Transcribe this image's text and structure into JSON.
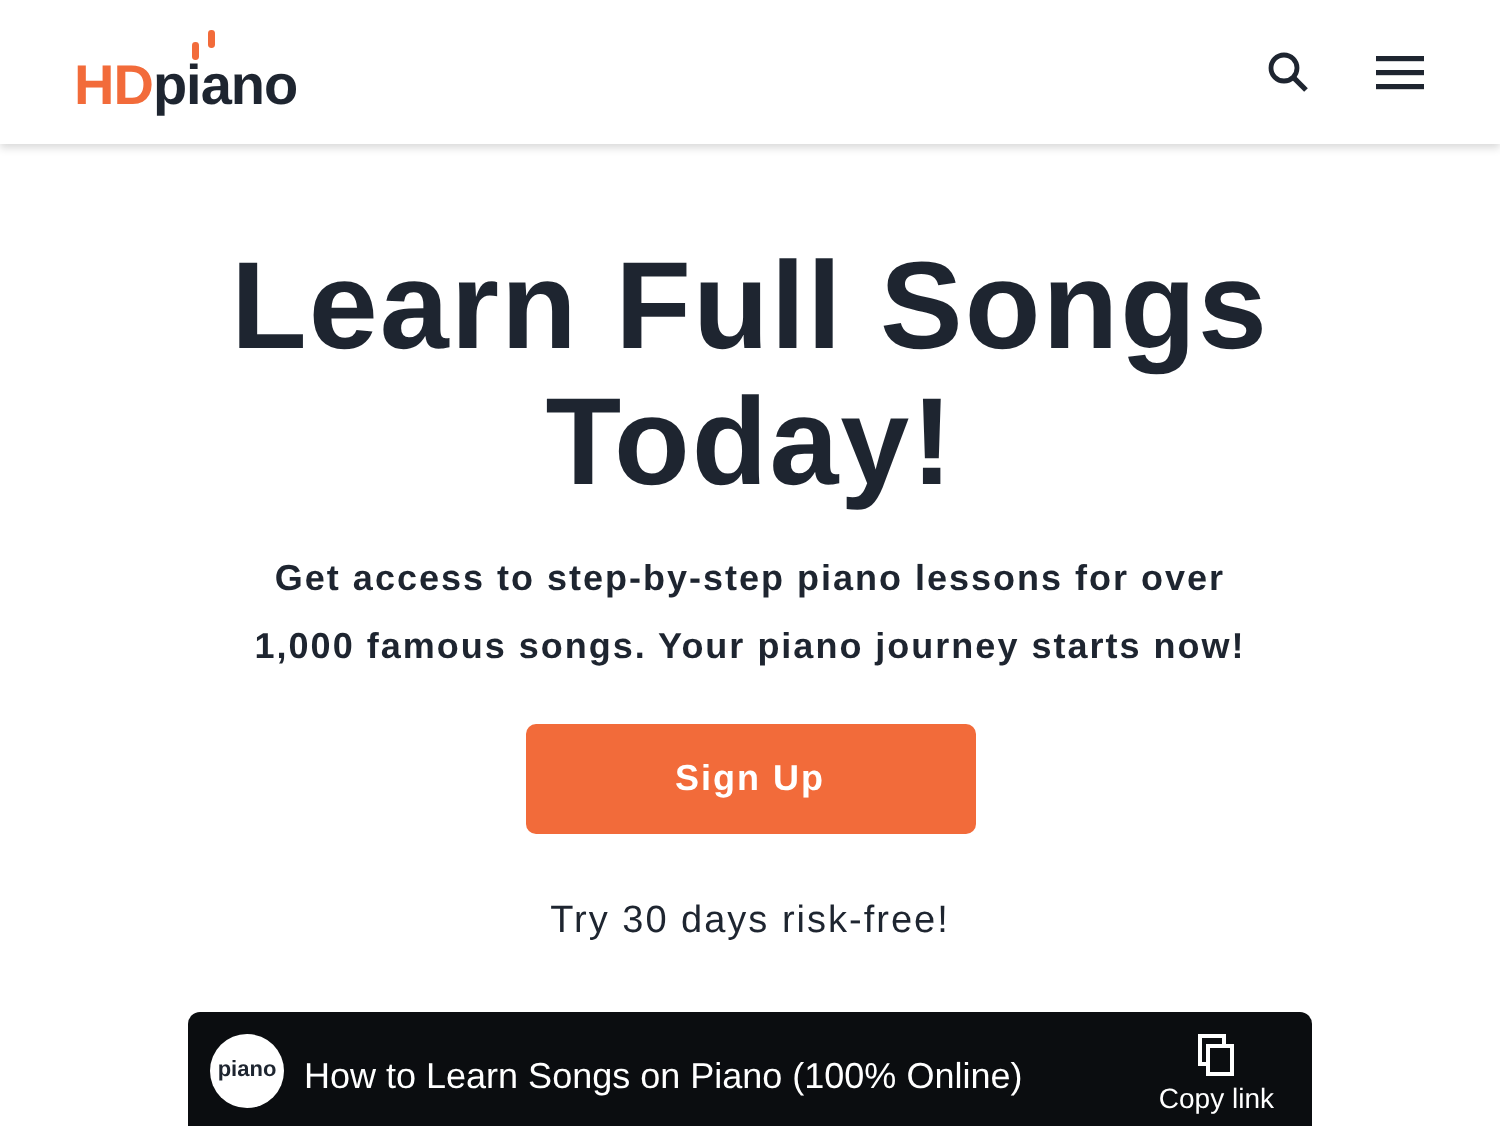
{
  "header": {
    "logo": {
      "prefix": "HD",
      "suffix": "piano"
    }
  },
  "hero": {
    "title": "Learn Full Songs Today!",
    "subtitle": "Get access to step-by-step piano lessons for over 1,000 famous songs. Your piano journey starts now!",
    "button": "Sign Up",
    "note": "Try 30 days risk-free!"
  },
  "video": {
    "channel": "piano",
    "title": "How to Learn Songs on Piano (100% Online)",
    "copy_link": "Copy link"
  }
}
